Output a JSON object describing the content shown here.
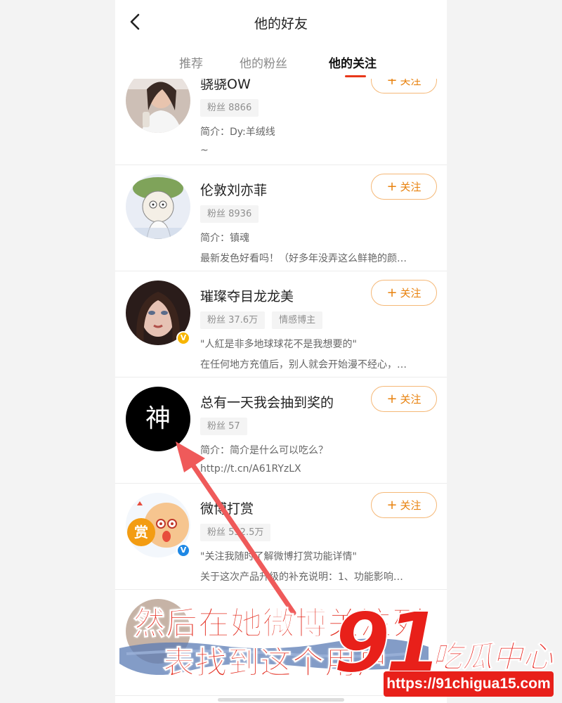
{
  "header": {
    "title": "他的好友"
  },
  "tabs": [
    {
      "label": "推荐"
    },
    {
      "label": "他的粉丝"
    },
    {
      "label": "他的关注"
    }
  ],
  "colors": {
    "accent": "#e8371a",
    "follow": "#e8820e",
    "caption": "#e3281b"
  },
  "follow_label": "关注",
  "users": [
    {
      "name": "骁骁OW",
      "tags": [
        "粉丝 8866"
      ],
      "line1": "简介：Dy:羊绒线",
      "line2": "~",
      "badge": ""
    },
    {
      "name": "伦敦刘亦菲",
      "tags": [
        "粉丝 8936"
      ],
      "line1": "简介：镇魂",
      "line2": "最新发色好看吗！（好多年没弄这么鲜艳的颜…",
      "badge": ""
    },
    {
      "name": "璀璨夺目龙龙美",
      "tags": [
        "粉丝 37.6万",
        "情感博主"
      ],
      "line1": "\"人紅是非多地球球花不是我想要的\"",
      "line2": "在任何地方充值后，别人就会开始漫不经心，…",
      "badge": "gold"
    },
    {
      "name": "总有一天我会抽到奖的",
      "tags": [
        "粉丝 57"
      ],
      "line1": "简介：简介是什么可以吃么？",
      "line2": "http://t.cn/A61RYzLX",
      "badge": "",
      "avatar_char": "神"
    },
    {
      "name": "微博打赏",
      "tags": [
        "粉丝 532.5万"
      ],
      "line1": "\"关注我随时了解微博打赏功能详情\"",
      "line2": "关于这次产品升级的补充说明：1、功能影响…",
      "badge": "blue",
      "avatar_char": "赏"
    }
  ],
  "overlay": {
    "caption_line1": "然后在她微博关注列",
    "caption_line2": "表找到这个用户",
    "watermark_number": "91",
    "watermark_name": "吃瓜中心",
    "watermark_url": "https://91chigua15.com"
  }
}
